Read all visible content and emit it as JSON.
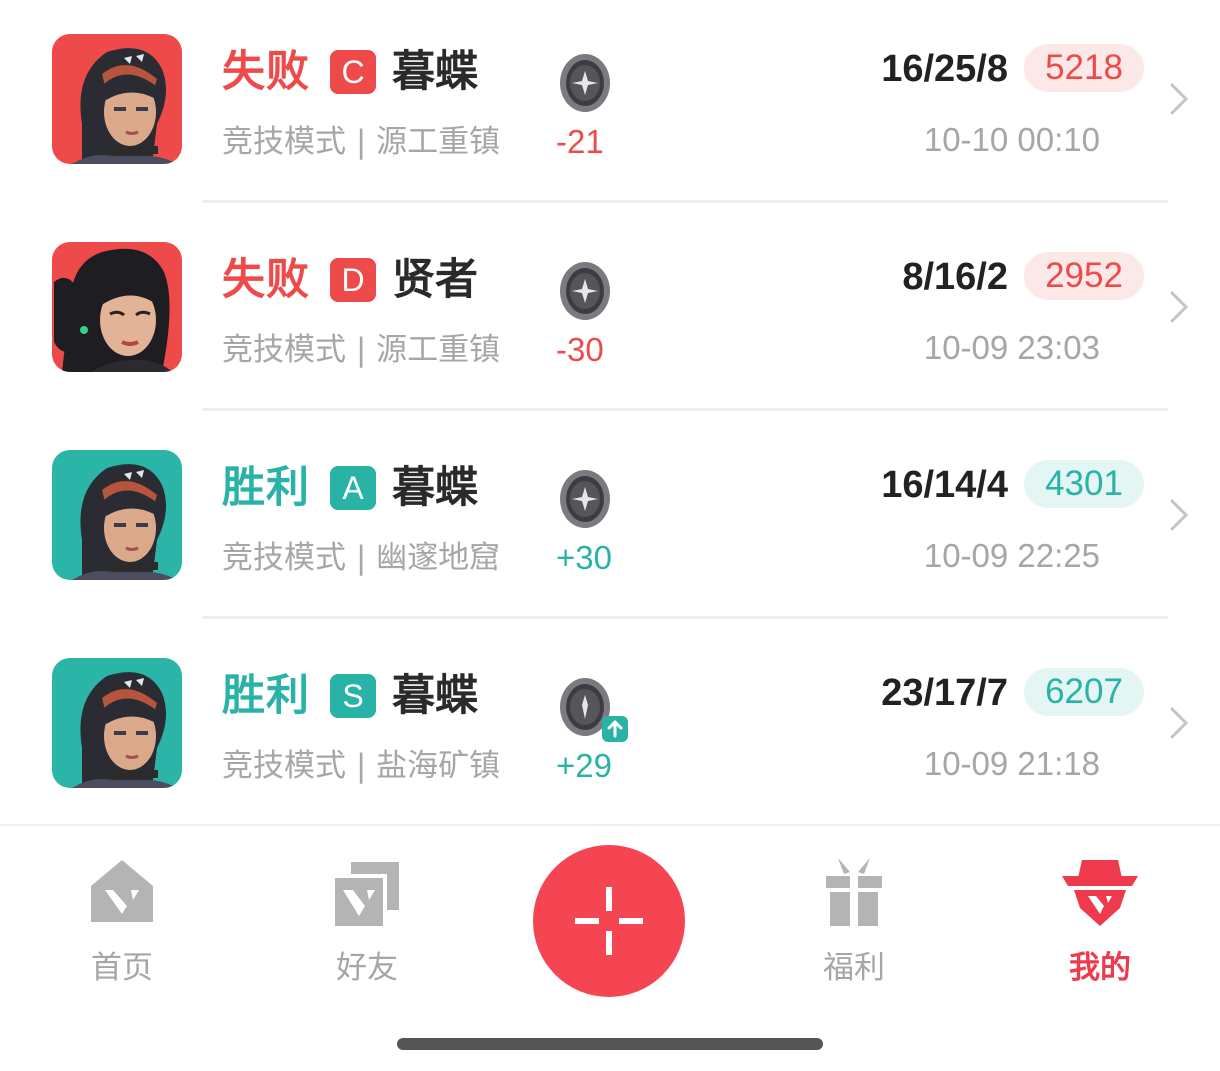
{
  "colors": {
    "defeat": "#ef4a4a",
    "victory": "#29b3a6",
    "defeat_badge_bg": "#fde8e8",
    "victory_badge_bg": "#e3f6f4",
    "accent": "#ee3a4c"
  },
  "matches": [
    {
      "result": "失败",
      "outcome": "defeat",
      "grade": "C",
      "agent": "暮蝶",
      "mode": "竞技模式 | 源工重镇",
      "rr_change": "-21",
      "kda": "16/25/8",
      "score": "5218",
      "time": "10-10 00:10",
      "rank_icon": "rank-emblem-icon",
      "rank_up": false
    },
    {
      "result": "失败",
      "outcome": "defeat",
      "grade": "D",
      "agent": "贤者",
      "mode": "竞技模式 | 源工重镇",
      "rr_change": "-30",
      "kda": "8/16/2",
      "score": "2952",
      "time": "10-09 23:03",
      "rank_icon": "rank-emblem-icon",
      "rank_up": false
    },
    {
      "result": "胜利",
      "outcome": "victory",
      "grade": "A",
      "agent": "暮蝶",
      "mode": "竞技模式 | 幽邃地窟",
      "rr_change": "+30",
      "kda": "16/14/4",
      "score": "4301",
      "time": "10-09 22:25",
      "rank_icon": "rank-emblem-icon",
      "rank_up": false
    },
    {
      "result": "胜利",
      "outcome": "victory",
      "grade": "S",
      "agent": "暮蝶",
      "mode": "竞技模式 | 盐海矿镇",
      "rr_change": "+29",
      "kda": "23/17/7",
      "score": "6207",
      "time": "10-09 21:18",
      "rank_icon": "rank-emblem-icon",
      "rank_up": true
    }
  ],
  "nav": {
    "home": "首页",
    "friends": "好友",
    "center_icon": "crosshair-plus-icon",
    "welfare": "福利",
    "mine": "我的",
    "active": "mine"
  }
}
